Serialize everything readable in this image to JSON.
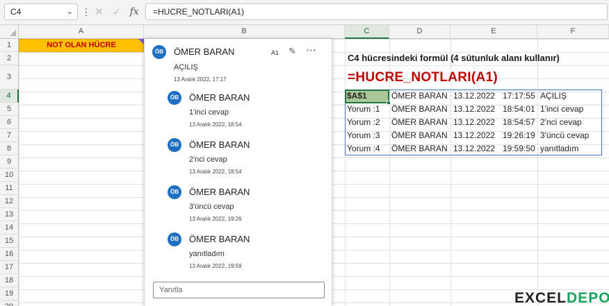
{
  "formula_bar": {
    "name_box": "C4",
    "formula": "=HUCRE_NOTLARI(A1)",
    "fx": "fx"
  },
  "columns": [
    {
      "key": "A",
      "label": "A"
    },
    {
      "key": "B",
      "label": "B"
    },
    {
      "key": "C",
      "label": "C"
    },
    {
      "key": "D",
      "label": "D"
    },
    {
      "key": "E",
      "label": "E"
    },
    {
      "key": "F",
      "label": "F"
    }
  ],
  "rows": [
    "1",
    "2",
    "3",
    "4",
    "5",
    "6",
    "7",
    "8",
    "9",
    "10",
    "11",
    "12",
    "13",
    "14",
    "15",
    "16",
    "17",
    "18",
    "19",
    "20"
  ],
  "cell_a1": "NOT OLAN HÜCRE",
  "comment_pane": {
    "thread": {
      "initials": "ÖB",
      "author": "ÖMER BARAN",
      "text": "AÇILIŞ",
      "date": "13 Aralık 2022, 17:17",
      "cell_ref": "A1"
    },
    "replies": [
      {
        "initials": "ÖB",
        "author": "ÖMER BARAN",
        "text": "1'inci cevap",
        "date": "13 Aralık 2022, 18:54"
      },
      {
        "initials": "ÖB",
        "author": "ÖMER BARAN",
        "text": "2'nci cevap",
        "date": "13 Aralık 2022, 18:54"
      },
      {
        "initials": "ÖB",
        "author": "ÖMER BARAN",
        "text": "3'üncü cevap",
        "date": "13 Aralık 2022, 19:26"
      },
      {
        "initials": "ÖB",
        "author": "ÖMER BARAN",
        "text": "yanıtladım",
        "date": "13 Aralık 2022, 19:59"
      }
    ],
    "reply_placeholder": "Yanıtla"
  },
  "info_text": "C4 hücresindeki formül (4 sütunluk alanı kullanır)",
  "big_formula": "=HUCRE_NOTLARI(A1)",
  "result_table": [
    [
      "$A$1",
      "ÖMER BARAN",
      "13.12.2022",
      "17:17:55",
      "AÇILIŞ"
    ],
    [
      "Yorum :1",
      "ÖMER BARAN",
      "13.12.2022",
      "18:54:01",
      "1'inci cevap"
    ],
    [
      "Yorum :2",
      "ÖMER BARAN",
      "13.12.2022",
      "18:54:57",
      "2'nci cevap"
    ],
    [
      "Yorum :3",
      "ÖMER BARAN",
      "13.12.2022",
      "19:26:19",
      "3'üncü cevap"
    ],
    [
      "Yorum :4",
      "ÖMER BARAN",
      "13.12.2022",
      "19:59:50",
      "yanıtladım"
    ]
  ],
  "brand": {
    "part1": "EXCEL",
    "part2": "DEPO"
  },
  "colors": {
    "accent": "#217346",
    "a1_fill": "#ffc000",
    "red_text": "#c00000",
    "table_border": "#4472c4",
    "avatar": "#1f6fc2"
  },
  "icons": {
    "cancel": "close-icon",
    "enter": "check-icon",
    "insert_function": "fx-icon"
  }
}
